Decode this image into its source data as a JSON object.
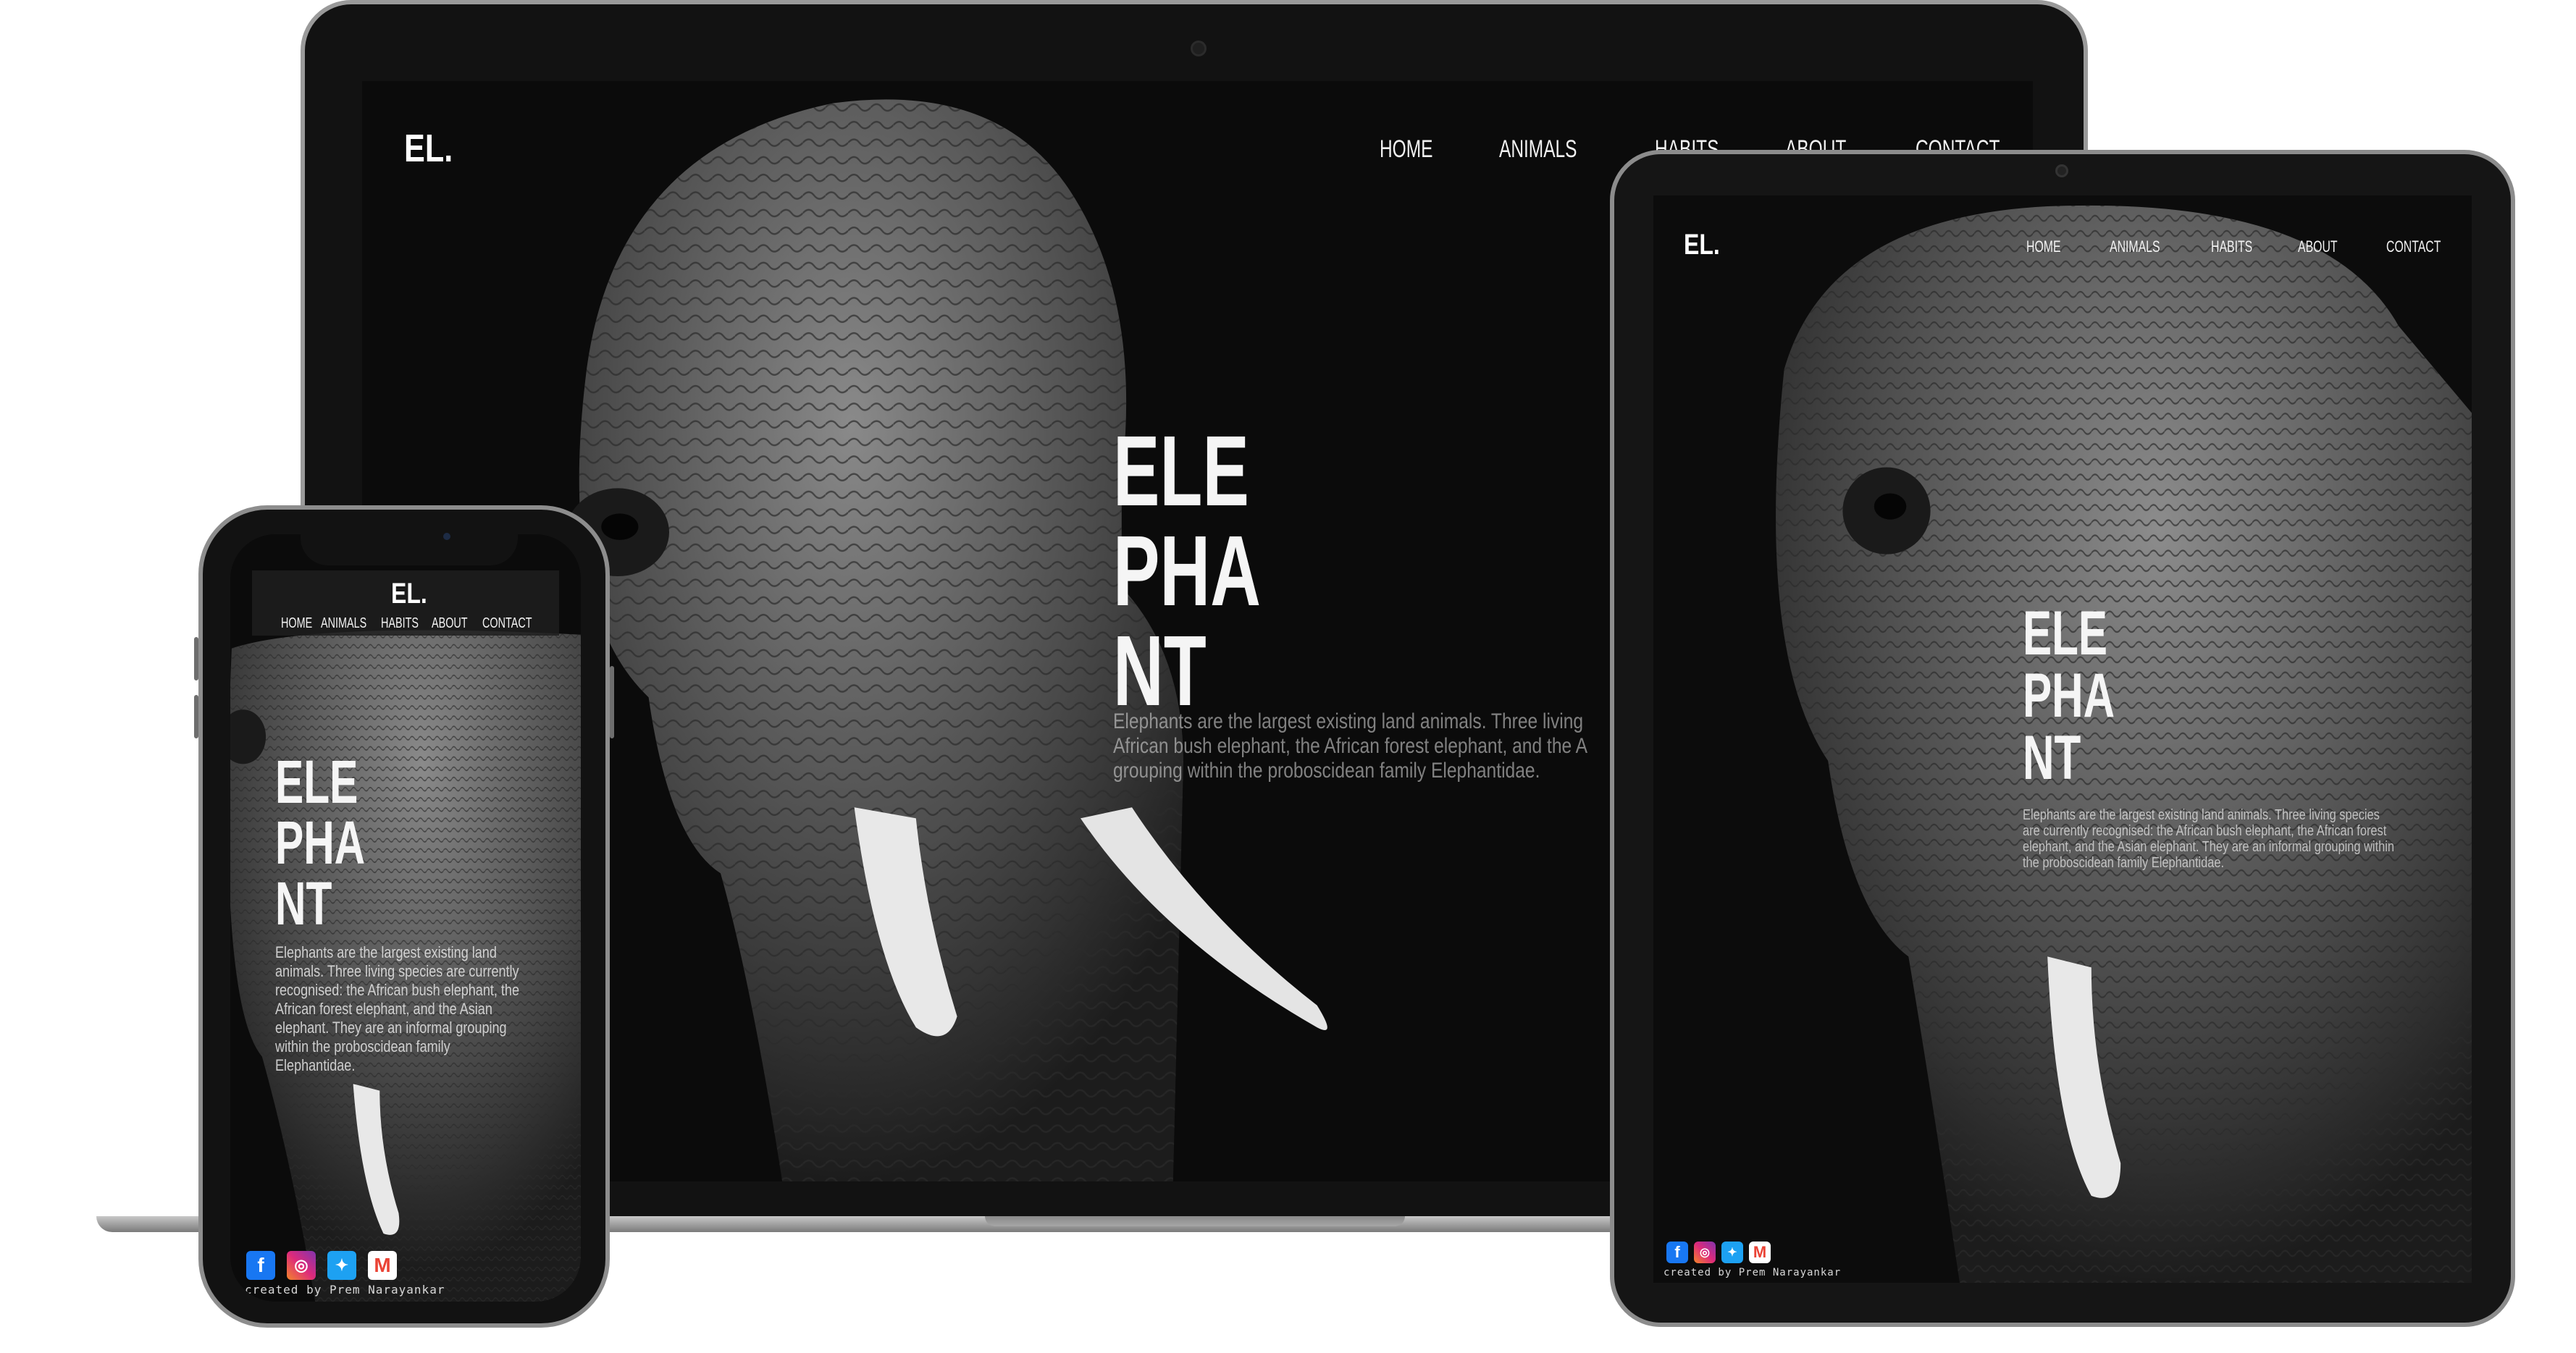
{
  "site": {
    "logo": "EL.",
    "nav": [
      "HOME",
      "ANIMALS",
      "HABITS",
      "ABOUT",
      "CONTACT"
    ],
    "hero_title_lines": [
      "ELE",
      "PHA",
      "NT"
    ],
    "description": "Elephants are the largest existing land animals. Three living species are currently recognised: the African bush elephant, the African forest elephant, and the Asian elephant. They are an informal grouping within the proboscidean family Elephantidae.",
    "laptop_description_lines": [
      "Elephants are the largest existing land animals. Three living",
      "African bush elephant, the African forest elephant, and the A",
      "grouping within the proboscidean family Elephantidae."
    ],
    "tablet_description_lines": [
      "Elephants are the largest existing land animals. Three living species",
      "are currently recognised: the African bush elephant, the African forest",
      "elephant, and the Asian elephant. They are an informal grouping within",
      "the proboscidean family Elephantidae."
    ],
    "phone_description_lines": [
      "Elephants are the largest existing land",
      "animals. Three living species are currently",
      "recognised: the African bush elephant, the",
      "African forest elephant, and the Asian",
      "elephant. They are an informal grouping",
      "within the proboscidean family",
      "Elephantidae."
    ],
    "credit": "created by Prem Narayankar",
    "social_icons": [
      "facebook-icon",
      "instagram-icon",
      "twitter-icon",
      "gmail-icon"
    ]
  },
  "colors": {
    "background": "#0b0b0b",
    "text": "#f2f2f2",
    "facebook": "#1877f2",
    "instagram": "#e1306c",
    "twitter": "#1da1f2",
    "gmail": "#ea4335"
  }
}
